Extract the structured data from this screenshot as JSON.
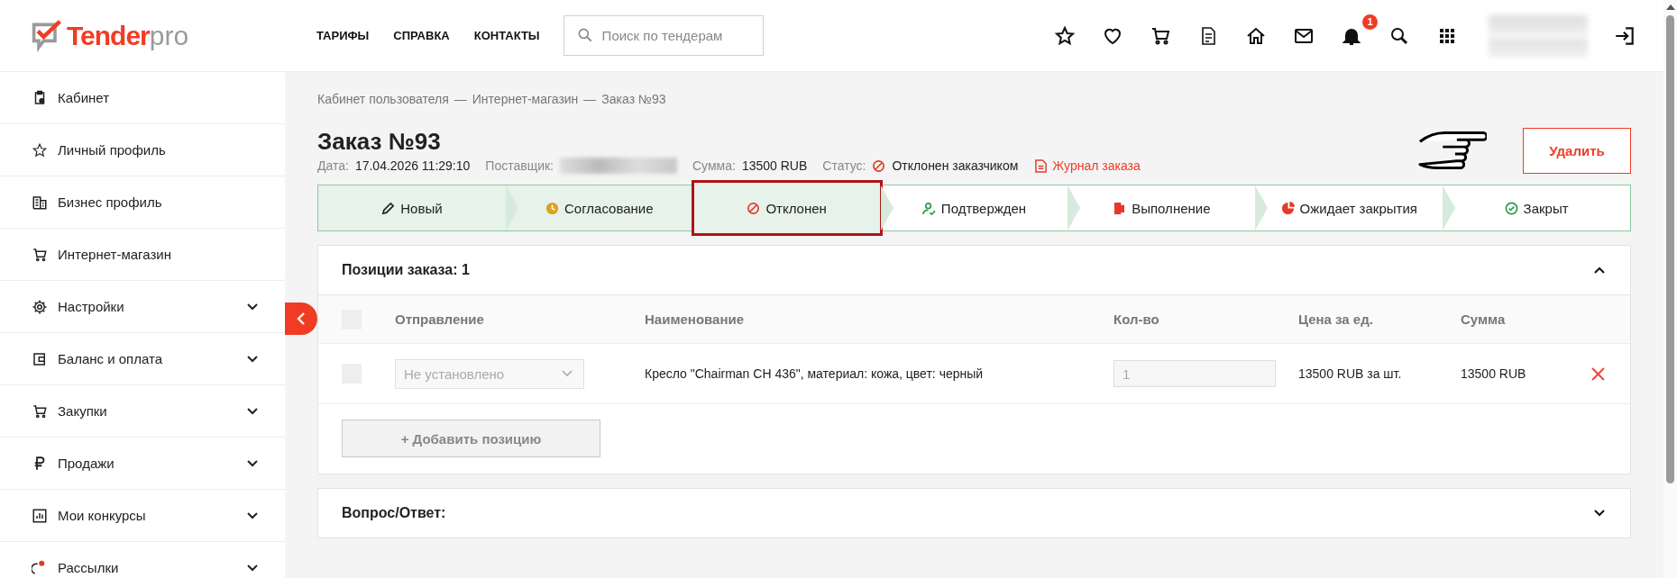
{
  "header": {
    "logo": {
      "brand": "Tender",
      "suffix": "pro"
    },
    "nav": [
      "ТАРИФЫ",
      "СПРАВКА",
      "КОНТАКТЫ"
    ],
    "search": {
      "placeholder": "Поиск по тендерам"
    },
    "toolbar": [
      {
        "kind": "star"
      },
      {
        "kind": "heart"
      },
      {
        "kind": "cart"
      },
      {
        "kind": "document"
      },
      {
        "kind": "home"
      },
      {
        "kind": "mail"
      },
      {
        "kind": "bell",
        "badge": "1"
      },
      {
        "kind": "search"
      },
      {
        "kind": "grid"
      }
    ]
  },
  "sidebar": {
    "items": [
      {
        "label": "Кабинет",
        "expandable": false
      },
      {
        "label": "Личный профиль",
        "expandable": false
      },
      {
        "label": "Бизнес профиль",
        "expandable": false
      },
      {
        "label": "Интернет-магазин",
        "expandable": false
      },
      {
        "label": "Настройки",
        "expandable": true
      },
      {
        "label": "Баланс и оплата",
        "expandable": true
      },
      {
        "label": "Закупки",
        "expandable": true
      },
      {
        "label": "Продажи",
        "expandable": true
      },
      {
        "label": "Мои конкурсы",
        "expandable": true
      },
      {
        "label": "Рассылки",
        "expandable": true
      }
    ]
  },
  "breadcrumb": {
    "separator": "—",
    "items": [
      "Кабинет пользователя",
      "Интернет-магазин",
      "Заказ №93"
    ]
  },
  "order": {
    "title": "Заказ №93",
    "meta": [
      {
        "kind": "text",
        "label": "Дата:",
        "value": "17.04.2026 11:29:10"
      },
      {
        "kind": "redacted",
        "label": "Поставщик:"
      },
      {
        "kind": "text",
        "label": "Сумма:",
        "value": "13500 RUB"
      },
      {
        "kind": "status",
        "label": "Статус:",
        "value": "Отклонен заказчиком"
      }
    ],
    "journal_link": "Журнал заказа",
    "delete_button": "Удалить"
  },
  "steps": [
    {
      "label": "Новый",
      "done": true,
      "selected": false
    },
    {
      "label": "Согласование",
      "done": true,
      "selected": false
    },
    {
      "label": "Отклонен",
      "done": true,
      "selected": true
    },
    {
      "label": "Подтвержден",
      "done": false,
      "selected": false
    },
    {
      "label": "Выполнение",
      "done": false,
      "selected": false
    },
    {
      "label": "Ожидает закрытия",
      "done": false,
      "selected": false
    },
    {
      "label": "Закрыт",
      "done": false,
      "selected": false
    }
  ],
  "positions": {
    "title": "Позиции заказа: 1",
    "expanded": true,
    "select_all": {
      "checked": false
    },
    "columns": [
      "Отправление",
      "Наименование",
      "Кол-во",
      "Цена за ед.",
      "Сумма"
    ],
    "rows": [
      {
        "checked": false,
        "shipping": {
          "placeholder": "Не установлено"
        },
        "name": "Кресло \"Chairman CH 436\", материал: кожа, цвет: черный",
        "quantity": "1",
        "price": "13500 RUB за шт.",
        "sum": "13500 RUB"
      }
    ],
    "add_button": "+ Добавить позицию"
  },
  "qa": {
    "title": "Вопрос/Ответ:",
    "expanded": false
  }
}
